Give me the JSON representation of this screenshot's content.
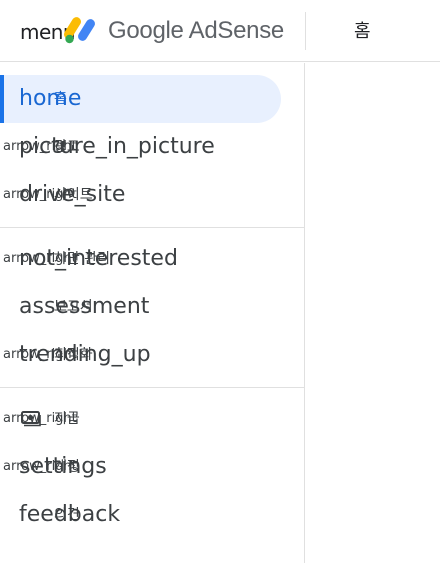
{
  "topbar": {
    "menu_label": "menu",
    "brand_text": "Google AdSense",
    "page_title": "홈"
  },
  "colors": {
    "accent": "#1a73e8",
    "active_bg": "#e8f0fe",
    "logo_yellow": "#fbbc04",
    "logo_blue": "#4285f4",
    "logo_green": "#34a853"
  },
  "nav": [
    {
      "arrow": "",
      "icon": "home",
      "label": "홈",
      "active": true
    },
    {
      "arrow": "arrow_right",
      "icon": "picture_in_picture",
      "label": "광고",
      "active": false
    },
    {
      "arrow": "arrow_right",
      "icon": "drive_site",
      "label": "사이트",
      "active": false
    },
    {
      "arrow": "arrow_right",
      "icon": "not_interested",
      "label": "차단 관리",
      "active": false
    },
    {
      "arrow": "",
      "icon": "assessment",
      "label": "보고서",
      "active": false
    },
    {
      "arrow": "arrow_right",
      "icon": "trending_up",
      "label": "최적화",
      "active": false
    },
    {
      "arrow": "arrow_right",
      "icon": "payments-icon",
      "label": "지급",
      "active": false
    },
    {
      "arrow": "arrow_right",
      "icon": "settings",
      "label": "계정",
      "active": false
    },
    {
      "arrow": "",
      "icon": "feedback",
      "label": "의견",
      "active": false
    }
  ]
}
